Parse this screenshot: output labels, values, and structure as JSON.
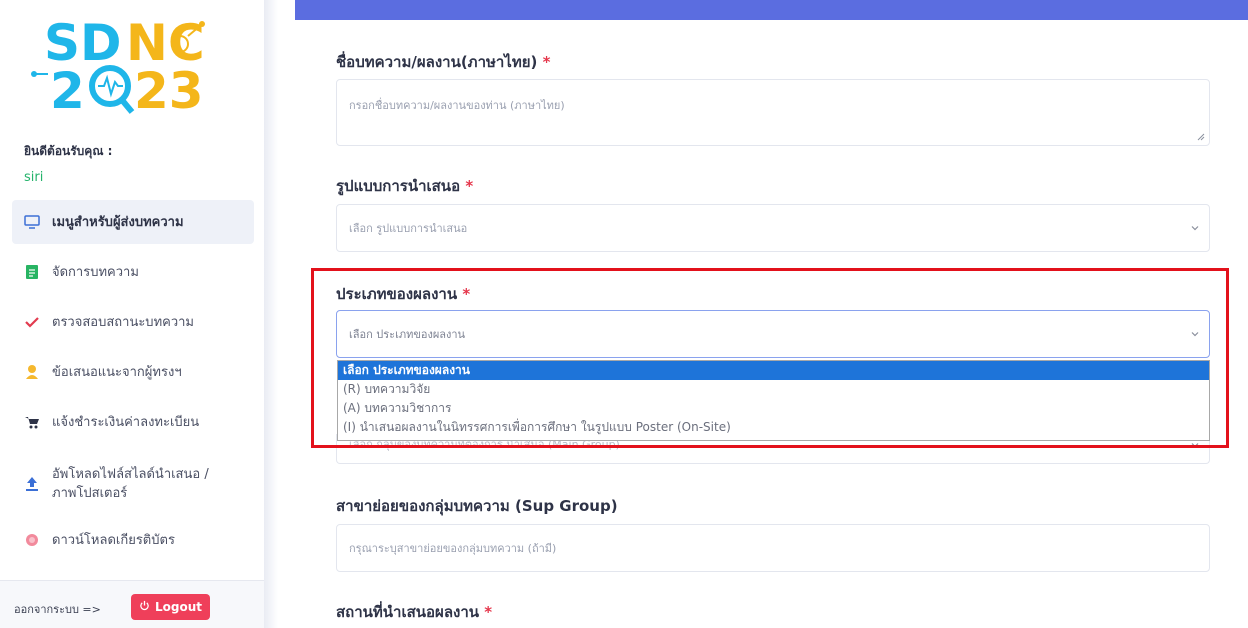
{
  "sidebar": {
    "logo_text": "SDNC 2023",
    "welcome": "ยินดีต้อนรับคุณ :",
    "username": "siri",
    "items": [
      {
        "label": "เมนูสำหรับผู้ส่งบทความ",
        "icon": "monitor-icon",
        "active": true
      },
      {
        "label": "จัดการบทความ",
        "icon": "document-icon"
      },
      {
        "label": "ตรวจสอบสถานะบทความ",
        "icon": "checkmark-icon"
      },
      {
        "label": "ข้อเสนอแนะจากผู้ทรงฯ",
        "icon": "user-icon"
      },
      {
        "label": "แจ้งชำระเงินค่าลงทะเบียน",
        "icon": "cart-icon"
      },
      {
        "label": "อัพโหลดไฟล์สไลด์นำเสนอ / ภาพโปสเตอร์",
        "icon": "upload-icon"
      },
      {
        "label": "ดาวน์โหลดเกียรติบัตร",
        "icon": "badge-icon"
      }
    ],
    "logout_text": "ออกจากระบบ =>",
    "logout_button": "Logout"
  },
  "form": {
    "title_th": {
      "label": "ชื่อบทความ/ผลงาน(ภาษาไทย)",
      "required": "*",
      "placeholder": "กรอกชื่อบทความ/ผลงานของท่าน (ภาษาไทย)"
    },
    "presentation": {
      "label": "รูปแบบการนำเสนอ",
      "required": "*",
      "value": "เลือก รูปแบบการนำเสนอ"
    },
    "work_type": {
      "label": "ประเภทของผลงาน",
      "required": "*",
      "value": "เลือก ประเภทของผลงาน",
      "options": [
        "เลือก ประเภทของผลงาน",
        "(R) บทความวิจัย",
        "(A) บทความวิชาการ",
        "(I) นำเสนอผลงานในนิทรรศการเพื่อการศึกษา ในรูปแบบ Poster (On-Site)"
      ]
    },
    "main_group_partial": "เลือก กลุ่มของบทความที่ต้องการ นำเสนอ (Main Group)",
    "sub_group": {
      "label": "สาขาย่อยของกลุ่มบทความ (Sup Group)",
      "placeholder": "กรุณาระบุสาขาย่อยของกลุ่มบทความ (ถ้ามี)"
    },
    "venue": {
      "label": "สถานที่นำเสนอผลงาน",
      "required": "*"
    }
  },
  "colors": {
    "accent": "#5b6de0",
    "logout": "#ef3f5a",
    "required": "#e5364b",
    "highlight": "#e3111b",
    "selected_option": "#1e74d9"
  }
}
